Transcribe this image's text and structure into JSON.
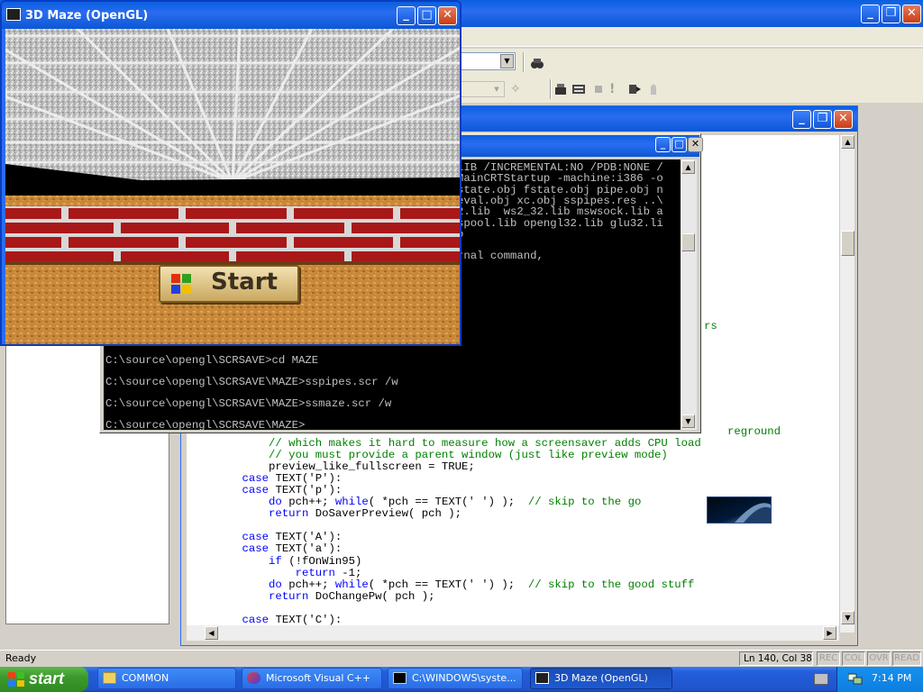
{
  "maze_window": {
    "title": "3D Maze (OpenGL)",
    "start_label": "Start"
  },
  "console_window": {
    "lines": [
      "LIB /INCREMENTAL:NO /PDB:NONE /",
      "MainCRTStartup -machine:i386 -o",
      "state.obj fstate.obj pipe.obj n",
      "eval.obj xc.obj sspipes.res ..\\",
      "2.lib  ws2_32.lib mswsock.lib a",
      "spool.lib opengl32.lib glu32.li",
      "o",
      "",
      "rnal command,"
    ],
    "commands": [
      "C:\\source\\opengl\\SCRSAVE>cd MAZE",
      "C:\\source\\opengl\\SCRSAVE\\MAZE>sspipes.scr /w",
      "C:\\source\\opengl\\SCRSAVE\\MAZE>ssmaze.scr /w",
      "C:\\source\\opengl\\SCRSAVE\\MAZE>"
    ]
  },
  "editor": {
    "fragment_rs": "rs",
    "fragment_reground": "reground",
    "code": [
      {
        "indent": "        ",
        "parts": [
          [
            "cm",
            "// which makes it hard to measure how a screensaver adds CPU load"
          ]
        ]
      },
      {
        "indent": "        ",
        "parts": [
          [
            "cm",
            "// you must provide a parent window (just like preview mode)"
          ]
        ]
      },
      {
        "indent": "        ",
        "parts": [
          [
            "",
            "preview_like_fullscreen = TRUE;"
          ]
        ]
      },
      {
        "indent": "    ",
        "parts": [
          [
            "kw",
            "case"
          ],
          [
            "",
            " TEXT('P'):"
          ]
        ]
      },
      {
        "indent": "    ",
        "parts": [
          [
            "kw",
            "case"
          ],
          [
            "",
            " TEXT('p'):"
          ]
        ]
      },
      {
        "indent": "        ",
        "parts": [
          [
            "kw",
            "do"
          ],
          [
            "",
            " pch++; "
          ],
          [
            "kw",
            "while"
          ],
          [
            "",
            "( *pch == TEXT(' ') );  "
          ],
          [
            "cm",
            "// skip to the go"
          ]
        ]
      },
      {
        "indent": "        ",
        "parts": [
          [
            "kw",
            "return"
          ],
          [
            "",
            " DoSaverPreview( pch );"
          ]
        ]
      },
      {
        "indent": "",
        "parts": []
      },
      {
        "indent": "    ",
        "parts": [
          [
            "kw",
            "case"
          ],
          [
            "",
            " TEXT('A'):"
          ]
        ]
      },
      {
        "indent": "    ",
        "parts": [
          [
            "kw",
            "case"
          ],
          [
            "",
            " TEXT('a'):"
          ]
        ]
      },
      {
        "indent": "        ",
        "parts": [
          [
            "kw",
            "if"
          ],
          [
            "",
            " (!fOnWin95)"
          ]
        ]
      },
      {
        "indent": "            ",
        "parts": [
          [
            "kw",
            "return"
          ],
          [
            "",
            " -1;"
          ]
        ]
      },
      {
        "indent": "        ",
        "parts": [
          [
            "kw",
            "do"
          ],
          [
            "",
            " pch++; "
          ],
          [
            "kw",
            "while"
          ],
          [
            "",
            "( *pch == TEXT(' ') );  "
          ],
          [
            "cm",
            "// skip to the good stuff"
          ]
        ]
      },
      {
        "indent": "        ",
        "parts": [
          [
            "kw",
            "return"
          ],
          [
            "",
            " DoChangePw( pch );"
          ]
        ]
      },
      {
        "indent": "",
        "parts": []
      },
      {
        "indent": "    ",
        "parts": [
          [
            "kw",
            "case"
          ],
          [
            "",
            " TEXT('C'):"
          ]
        ]
      }
    ]
  },
  "status_bar": {
    "ready": "Ready",
    "position": "Ln 140, Col 38",
    "indicators": [
      "REC",
      "COL",
      "OVR",
      "READ"
    ]
  },
  "taskbar": {
    "start_label": "start",
    "buttons": [
      {
        "label": "COMMON",
        "icon": "folder-icon"
      },
      {
        "label": "Microsoft Visual C++",
        "icon": "visual-cpp-icon"
      },
      {
        "label": "C:\\WINDOWS\\syste...",
        "icon": "console-icon"
      },
      {
        "label": "3D Maze (OpenGL)",
        "icon": "maze-app-icon",
        "active": true
      }
    ],
    "clock": "7:14 PM"
  },
  "colors": {
    "xp_blue": "#2a6cf0",
    "taskbar": "#245edb",
    "start_green": "#3c9a2c",
    "code_keyword": "#0000ff",
    "code_comment": "#008000"
  }
}
